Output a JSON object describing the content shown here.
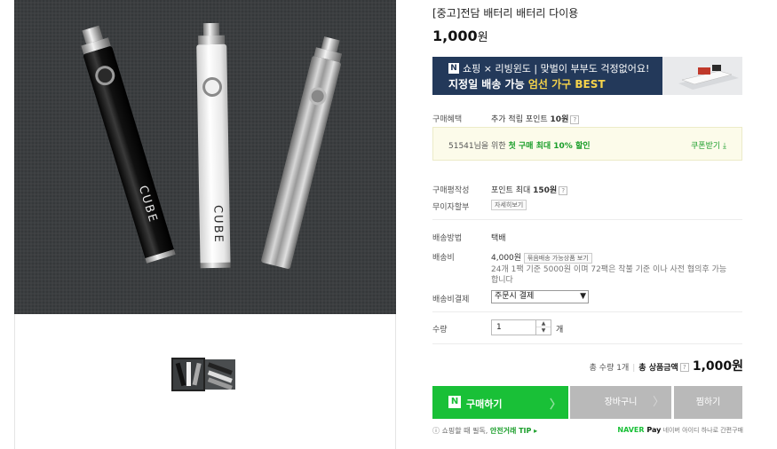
{
  "product": {
    "title": "[중고]전담 배터리 배터리 다이용",
    "price_value": "1,000",
    "price_unit": "원"
  },
  "banner": {
    "n_logo": "N",
    "line1": "쇼핑 × 리빙윈도 | 맞벌이 부부도 걱정없어요!",
    "line2_prefix": "지정일 배송 가능 ",
    "line2_highlight": "엄선 가구 BEST"
  },
  "benefits": {
    "label": "구매혜택",
    "value": "추가 적립 포인트 ",
    "points": "10원",
    "help": "?"
  },
  "coupon": {
    "prefix": "51541님을 위한 ",
    "highlight": "첫 구매 최대 10% 할인",
    "get_label": "쿠폰받기 ⤓"
  },
  "review": {
    "label": "구매평작성",
    "value": "포인트 최대 ",
    "points": "150원",
    "help": "?"
  },
  "installment": {
    "label": "무이자할부",
    "button": "자세히보기"
  },
  "shipping": {
    "method_label": "배송방법",
    "method_value": "택배",
    "fee_label": "배송비",
    "fee_value": "4,000원",
    "fee_button": "묶음배송 가능상품 보기",
    "fee_note_1": "24개 1팩 기준 5000원 이며 72팩은 착불 기준 이나 사전 협의후 가능",
    "fee_note_2": "합니다",
    "payment_label": "배송비결제",
    "payment_selected": "주문시 결제"
  },
  "quantity": {
    "label": "수량",
    "value": "1",
    "unit": "개"
  },
  "totals": {
    "count_text": "총 수량 1개",
    "amount_label": "총 상품금액",
    "help": "?",
    "amount": "1,000원"
  },
  "actions": {
    "buy_logo": "N",
    "buy_label": "구매하기",
    "cart_label": "장바구니",
    "wish_label": "찜하기"
  },
  "footer": {
    "notice": "ⓘ 쇼핑할 때 필독, ",
    "notice_link": "안전거래 TIP ▸",
    "naverpay_brand_1": "NAVER",
    "naverpay_brand_2": " Pay",
    "naverpay_text": " 네이버 아이디 하나로 간편구매"
  },
  "image_text": {
    "battery_brand": "CUBE"
  },
  "colors": {
    "buy_green": "#19c037",
    "banner_navy": "#23395a",
    "banner_highlight": "#f7d44a",
    "gray_button": "#b9b9b9"
  }
}
